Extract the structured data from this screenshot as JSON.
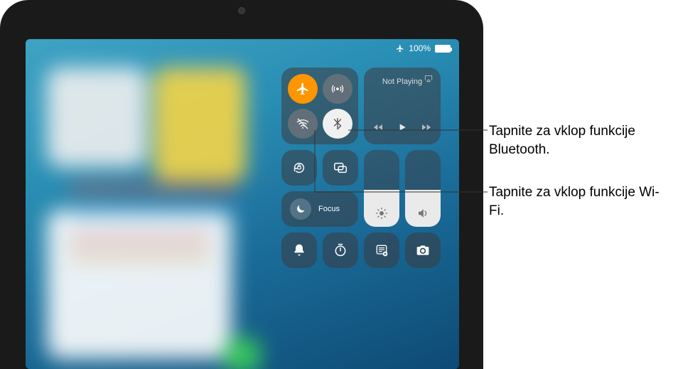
{
  "status": {
    "battery_text": "100%"
  },
  "connectivity": {
    "airplane_on": true,
    "wifi_on": false,
    "bluetooth_on": false,
    "airdrop_on": false
  },
  "media": {
    "title": "Not Playing"
  },
  "focus": {
    "label": "Focus"
  },
  "callouts": {
    "bluetooth": "Tapnite za vklop funkcije Bluetooth.",
    "wifi": "Tapnite za vklop funkcije Wi-Fi."
  }
}
